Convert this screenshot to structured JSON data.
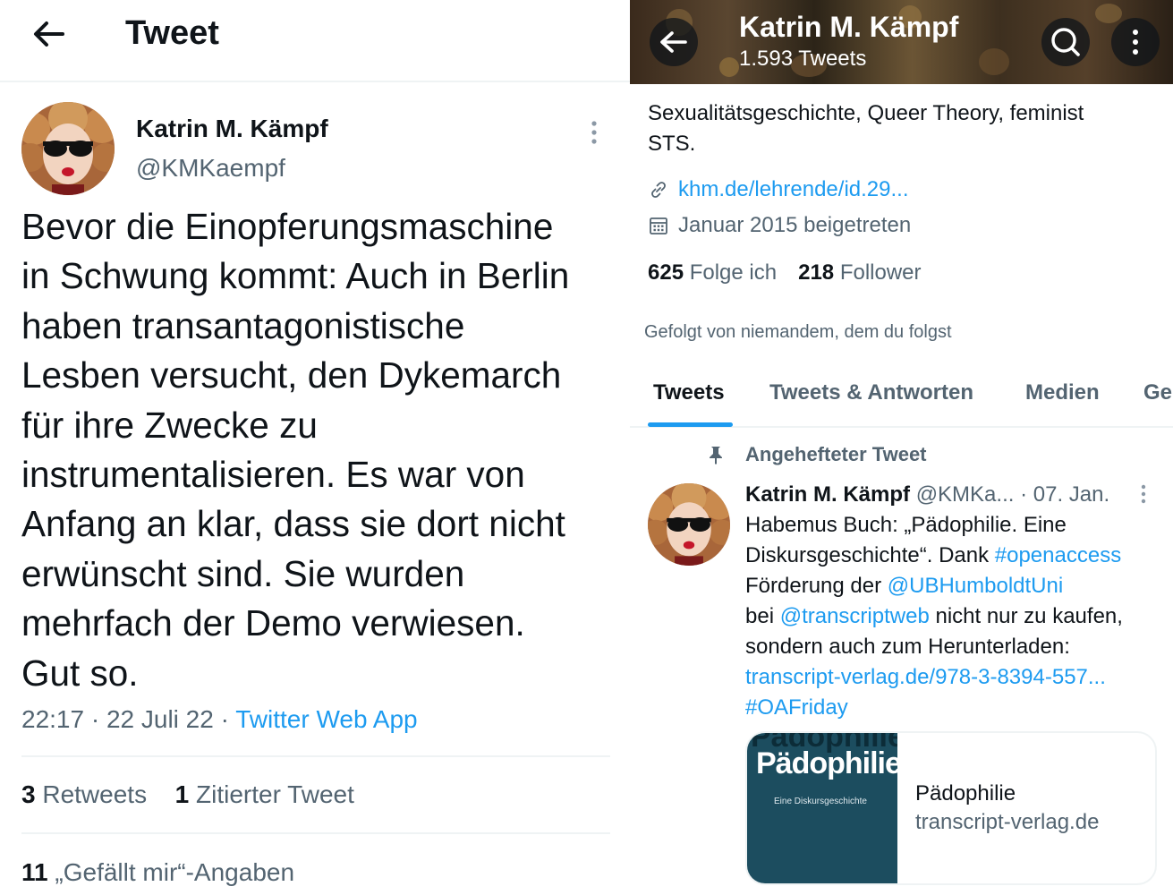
{
  "colors": {
    "accent": "#1d9bf0",
    "text_primary": "#0f1419",
    "text_secondary": "#536471",
    "divider": "#eff3f4"
  },
  "icons": {
    "back": "arrow-left-icon",
    "more": "more-vertical-icon",
    "search": "search-icon",
    "link": "link-icon",
    "calendar": "calendar-icon",
    "pin": "pin-icon"
  },
  "tweet_detail": {
    "header_title": "Tweet",
    "author": {
      "name": "Katrin M. Kämpf",
      "handle": "@KMKaempf"
    },
    "text_lines": [
      "Bevor die Einopferungsmaschine",
      "in Schwung kommt: Auch in Berlin",
      "haben transantagonistische",
      "Lesben versucht, den Dykemarch",
      "für ihre Zwecke zu",
      "instrumentalisieren. Es war von",
      "Anfang an klar, dass sie dort nicht",
      "erwünscht sind. Sie wurden",
      "mehrfach der Demo verwiesen.",
      "Gut so."
    ],
    "time": "22:17",
    "date": "22 Juli 22",
    "separator": "·",
    "source": "Twitter Web App",
    "stats": {
      "retweets_count": "3",
      "retweets_label": "Retweets",
      "quotes_count": "1",
      "quotes_label": "Zitierter Tweet",
      "likes_count": "11",
      "likes_label": "„Gefällt mir“-Angaben"
    }
  },
  "profile": {
    "name": "Katrin M. Kämpf",
    "tweet_count": "1.593 Tweets",
    "bio_lines": [
      "Sexualitätsgeschichte, Queer Theory, feminist",
      "STS."
    ],
    "link": "khm.de/lehrende/id.29...",
    "joined": "Januar 2015 beigetreten",
    "following_count": "625",
    "following_label": "Folge ich",
    "followers_count": "218",
    "followers_label": "Follower",
    "followed_by": "Gefolgt von niemandem, dem du folgst",
    "tabs": [
      "Tweets",
      "Tweets & Antworten",
      "Medien",
      "Ge"
    ],
    "active_tab": "Tweets",
    "pinned": {
      "label": "Angehefteter Tweet",
      "author_name": "Katrin M. Kämpf",
      "author_handle": "@KMKa...",
      "date": "· 07. Jan.",
      "body": {
        "l1": "Habemus Buch: „Pädophilie. Eine",
        "l2a": "Diskursgeschichte“. Dank ",
        "l2b": "#openaccess",
        "l3a": "Förderung der ",
        "l3b": "@UBHumboldtUni",
        "l4a": "bei ",
        "l4b": "@transcriptweb",
        "l4c": " nicht nur zu kaufen,",
        "l5": "sondern auch zum Herunterladen:",
        "l6": "transcript-verlag.de/978-3-8394-557...",
        "l7": "#OAFriday"
      },
      "card": {
        "cover_title": "Pädophilie",
        "cover_subtitle": "Eine Diskursgeschichte",
        "title": "Pädophilie",
        "domain": "transcript-verlag.de"
      }
    }
  }
}
